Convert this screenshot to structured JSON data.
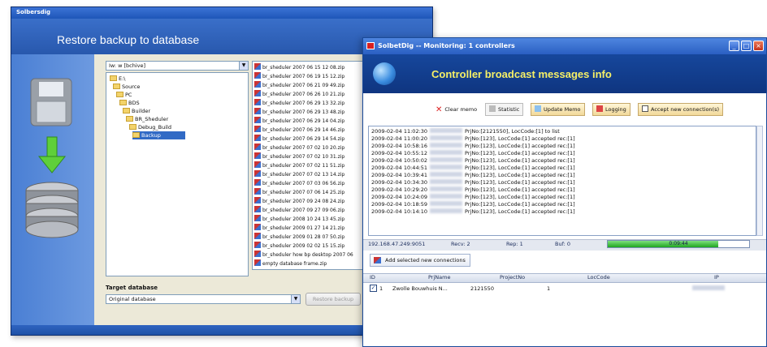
{
  "restore_window": {
    "title": "Solbersdig",
    "header_title": "Restore backup to database",
    "drive_combo": "Iw: w [bchive]",
    "tree": [
      "E:\\",
      "Source",
      "PC",
      "BDS",
      "Builder",
      "BR_Sheduler",
      "Debug_Build",
      "Backup"
    ],
    "files": [
      "br_sheduler 2007 06 15 12 08.zip",
      "br_sheduler 2007 06 19 15 12.zip",
      "br_sheduler 2007 06 21 09 49.zip",
      "br_sheduler 2007 06 26 10 21.zip",
      "br_sheduler 2007 06 29 13 32.zip",
      "br_sheduler 2007 06 29 13 48.zip",
      "br_sheduler 2007 06 29 14 04.zip",
      "br_sheduler 2007 06 29 14 46.zip",
      "br_sheduler 2007 06 29 14 54.zip",
      "br_sheduler 2007 07 02 10 20.zip",
      "br_sheduler 2007 07 02 10 31.zip",
      "br_sheduler 2007 07 02 11 51.zip",
      "br_sheduler 2007 07 02 13 14.zip",
      "br_sheduler 2007 07 03 06 56.zip",
      "br_sheduler 2007 07 06 14 25.zip",
      "br_sheduler 2007 09 24 08 24.zip",
      "br_sheduler 2007 09 27 09 06.zip",
      "br_sheduler 2008 10 24 13 45.zip",
      "br_sheduler 2009 01 27 14 21.zip",
      "br_sheduler 2009 01 28 07 50.zip",
      "br_sheduler 2009 02 02 15 15.zip",
      "br_sheduler how bp desktop 2007 06",
      "empty database frame.zip"
    ],
    "target_label": "Target database",
    "target_value": "Original database",
    "restore_button": "Restore backup"
  },
  "monitor_window": {
    "title": "SolbetDig -- Monitoring: 1 controllers",
    "banner_title": "Controller broadcast messages info",
    "toolbar": {
      "clear": "Clear memo",
      "statistic": "Statistic",
      "update": "Update Memo",
      "logging": "Logging",
      "accept": "Accept new connection(s)"
    },
    "log": [
      {
        "ts": "2009-02-04 11:02:30",
        "msg": "PrjNo:[2121550], LocCode:[1] to list"
      },
      {
        "ts": "2009-02-04 11:00:20",
        "msg": "PrjNo:[123], LocCode:[1] accepted rec:[1]"
      },
      {
        "ts": "2009-02-04 10:58:16",
        "msg": "PrjNo:[123], LocCode:[1] accepted rec:[1]"
      },
      {
        "ts": "2009-02-04 10:55:12",
        "msg": "PrjNo:[123], LocCode:[1] accepted rec:[1]"
      },
      {
        "ts": "2009-02-04 10:50:02",
        "msg": "PrjNo:[123], LocCode:[1] accepted rec:[1]"
      },
      {
        "ts": "2009-02-04 10:44:51",
        "msg": "PrjNo:[123], LocCode:[1] accepted rec:[1]"
      },
      {
        "ts": "2009-02-04 10:39:41",
        "msg": "PrjNo:[123], LocCode:[1] accepted rec:[1]"
      },
      {
        "ts": "2009-02-04 10:34:30",
        "msg": "PrjNo:[123], LocCode:[1] accepted rec:[1]"
      },
      {
        "ts": "2009-02-04 10:29:20",
        "msg": "PrjNo:[123], LocCode:[1] accepted rec:[1]"
      },
      {
        "ts": "2009-02-04 10:24:09",
        "msg": "PrjNo:[123], LocCode:[1] accepted rec:[1]"
      },
      {
        "ts": "2009-02-04 10:18:59",
        "msg": "PrjNo:[123], LocCode:[1] accepted rec:[1]"
      },
      {
        "ts": "2009-02-04 10:14:10",
        "msg": "PrjNo:[123], LocCode:[1] accepted rec:[1]"
      }
    ],
    "status": {
      "address": "192.168.47.249:9051",
      "recv": "Recv: 2",
      "rep": "Rep: 1",
      "buf": "Buf: 0",
      "progress_text": "0:09:44",
      "progress": 0.78
    },
    "add_button": "Add selected new connections",
    "grid": {
      "headers": [
        "ID",
        "PrjName",
        "ProjectNo",
        "LocCode",
        "IP"
      ],
      "rows": [
        {
          "id": "1",
          "prjname": "Zwolle Bouwhuis N...",
          "projectno": "2121550",
          "loccode": "1"
        }
      ]
    },
    "colors": {
      "banner_text": "#f6f066",
      "banner_bg": "#0f3580",
      "progress": "#1fa51f"
    }
  }
}
